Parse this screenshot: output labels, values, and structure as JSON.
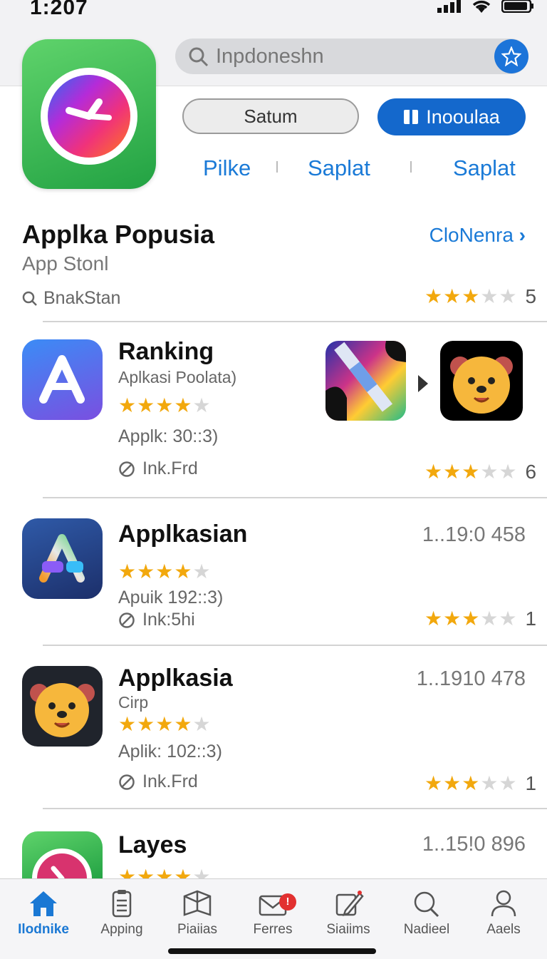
{
  "status": {
    "time": "1:207"
  },
  "search": {
    "placeholder": "Inpdoneshn"
  },
  "buttons": {
    "outline": "Satum",
    "primary": "Inooulaa"
  },
  "links": [
    "Pilke",
    "Saplat",
    "Saplat"
  ],
  "section": {
    "title": "Applka Popusia",
    "subtitle": "App Stonl",
    "link": "CloNenra",
    "tag": "BnakStan",
    "rating_count": "5",
    "stars": 3
  },
  "apps": [
    {
      "title": "Ranking",
      "subtitle": "Aplkasi Poolata)",
      "meta": "Applk: 30::3)",
      "ink": "Ink.Frd",
      "stars": 4,
      "right_stars": 3,
      "right_count": "6",
      "version": ""
    },
    {
      "title": "Applkasian",
      "subtitle": "",
      "meta": "Apuik 192::3)",
      "ink": "Ink:5hi",
      "stars": 4,
      "right_stars": 3,
      "right_count": "1",
      "version": "1..19:0 458"
    },
    {
      "title": "Applkasia",
      "subtitle": "Cirp",
      "meta": "Aplik: 102::3)",
      "ink": "Ink.Frd",
      "stars": 4,
      "right_stars": 3,
      "right_count": "1",
      "version": "1..1910 478"
    },
    {
      "title": "Layes",
      "subtitle": "",
      "meta": "",
      "ink": "",
      "stars": 4,
      "right_stars": 0,
      "right_count": "",
      "version": "1..15!0 896"
    }
  ],
  "tabs": [
    {
      "label": "Ilodnike",
      "icon": "home-icon",
      "active": true
    },
    {
      "label": "Apping",
      "icon": "clipboard-icon",
      "active": false
    },
    {
      "label": "Piaiias",
      "icon": "box-icon",
      "active": false
    },
    {
      "label": "Ferres",
      "icon": "mail-icon",
      "active": false,
      "badge": "!"
    },
    {
      "label": "Siaiims",
      "icon": "edit-icon",
      "active": false
    },
    {
      "label": "Nadieel",
      "icon": "search-icon",
      "active": false
    },
    {
      "label": "Aaels",
      "icon": "person-icon",
      "active": false
    }
  ],
  "colors": {
    "accent": "#1a7ad7",
    "primary_button": "#1468cc",
    "star": "#f2a80d"
  }
}
